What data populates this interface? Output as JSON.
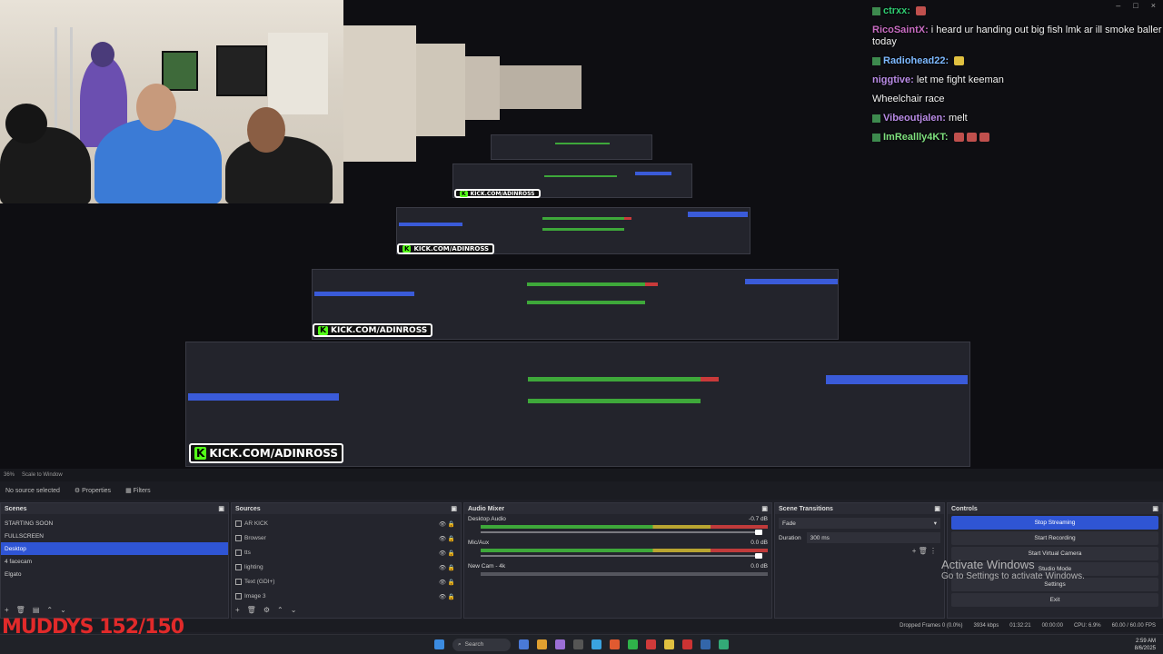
{
  "window_controls": [
    "–",
    "□",
    "×"
  ],
  "kick_watermark": "KICK.COM/ADINROSS",
  "chat": {
    "messages": [
      {
        "name": "ctrxx:",
        "text": "",
        "color": "#2ecc71",
        "emote": true
      },
      {
        "name": "RicoSaintX:",
        "text": "i heard ur handing out big fish lmk ar ill smoke baller today",
        "color": "#c76bc1",
        "emote": false
      },
      {
        "name": "Radiohead22:",
        "text": "",
        "color": "#7db9ff",
        "emote": true
      },
      {
        "name": "niggtive:",
        "text": "let me fight keeman",
        "color": "#b98be6",
        "emote": false
      },
      {
        "name": "",
        "text": "Wheelchair race",
        "color": "#d04a6f",
        "emote": false
      },
      {
        "name": "Vibeoutjalen:",
        "text": "melt",
        "color": "#b98be6",
        "emote": false
      },
      {
        "name": "ImReallly4KT:",
        "text": "",
        "color": "#7ee07e",
        "emote": true
      }
    ]
  },
  "toolbar": {
    "zoom": "36%",
    "scale_label": "Scale to Window"
  },
  "subbar": {
    "no_source": "No source selected",
    "properties": "Properties",
    "filters": "Filters"
  },
  "scenes": {
    "title": "Scenes",
    "items": [
      "STARTING SOON",
      "FULLSCREEN",
      "Desktop",
      "4 facecam",
      "Elgato"
    ],
    "selected": 2
  },
  "sources": {
    "title": "Sources",
    "items": [
      "AR KICK",
      "Browser",
      "tts",
      "lighting",
      "Text (GDI+)",
      "Image 3"
    ]
  },
  "mixer": {
    "title": "Audio Mixer",
    "channels": [
      {
        "name": "Desktop Audio",
        "db": "-0.7 dB"
      },
      {
        "name": "Mic/Aux",
        "db": "0.0 dB"
      },
      {
        "name": "New Cam - 4k",
        "db": "0.0 dB"
      }
    ]
  },
  "transitions": {
    "title": "Scene Transitions",
    "type": "Fade",
    "duration_label": "Duration",
    "duration_value": "300 ms"
  },
  "controls": {
    "title": "Controls",
    "buttons": [
      "Stop Streaming",
      "Start Recording",
      "Start Virtual Camera",
      "Studio Mode",
      "Settings",
      "Exit"
    ]
  },
  "status": {
    "dropped": "Dropped Frames 0 (0.0%)",
    "kbps": "3934 kbps",
    "time": "01:32:21",
    "rec": "00:00:00",
    "cpu": "CPU: 6.9%",
    "fps": "60.00 / 60.00 FPS"
  },
  "taskbar": {
    "search": "Search",
    "time": "2:59 AM",
    "date": "8/6/2025"
  },
  "activate": {
    "line1": "Activate Windows",
    "line2": "Go to Settings to activate Windows."
  },
  "sub_overlay": "MUDDYS 152/150"
}
